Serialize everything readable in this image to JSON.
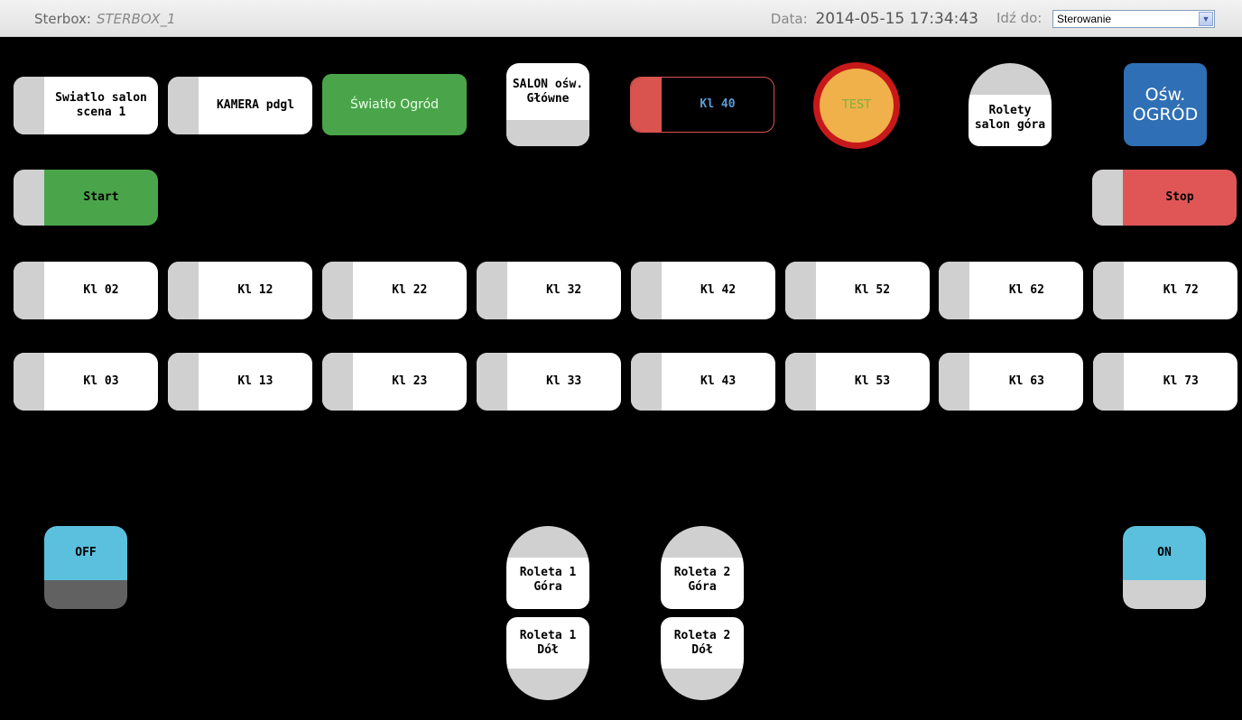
{
  "header": {
    "brand_label": "Sterbox:",
    "brand_name": "STERBOX_1",
    "date_label": "Data:",
    "date_value": "2014-05-15 17:34:43",
    "goto_label": "Idź do:",
    "goto_selected": "Sterowanie"
  },
  "buttons": {
    "swiatlo_salon": "Swiatlo salon scena 1",
    "kamera": "KAMERA pdgl",
    "swiatlo_ogrod": "Światło Ogród",
    "salon_osw": "SALON ośw. Główne",
    "kl40": "Kl 40",
    "test": "TEST",
    "rolety_salon": "Rolety salon góra",
    "osw_ogrod": "Ośw. OGRÓD",
    "start": "Start",
    "stop": "Stop",
    "off": "OFF",
    "on": "ON",
    "roleta1_gora": "Roleta 1 Góra",
    "roleta1_dol": "Roleta 1 Dół",
    "roleta2_gora": "Roleta 2 Góra",
    "roleta2_dol": "Roleta 2 Dół"
  },
  "row1": [
    "Kl 02",
    "Kl 12",
    "Kl 22",
    "Kl 32",
    "Kl 42",
    "Kl 52",
    "Kl 62",
    "Kl 72"
  ],
  "row2": [
    "Kl 03",
    "Kl 13",
    "Kl 23",
    "Kl 33",
    "Kl 43",
    "Kl 53",
    "Kl 63",
    "Kl 73"
  ],
  "colors": {
    "green": "#4aa54a",
    "red": "#e05656",
    "blue": "#2f6fb5",
    "cyan": "#5bc0de",
    "grey": "#d0d0d0"
  }
}
